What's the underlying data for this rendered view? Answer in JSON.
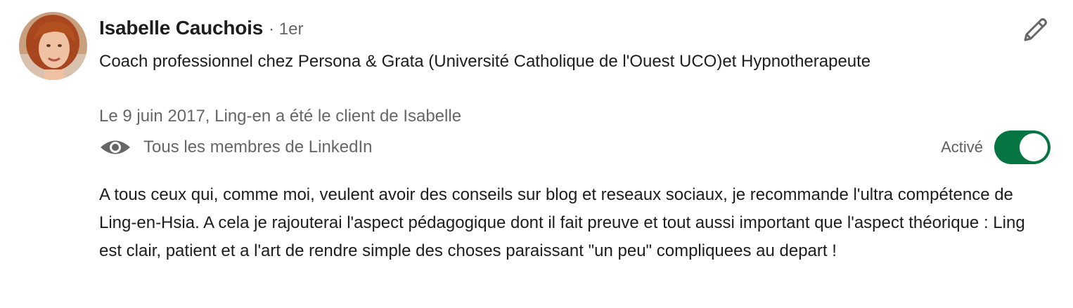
{
  "recommender": {
    "name": "Isabelle Cauchois",
    "degree": "· 1er",
    "headline": "Coach professionnel chez Persona & Grata (Université Catholique de l'Ouest UCO)et Hypnotherapeute",
    "relation": "Le 9 juin 2017, Ling-en a été le client de Isabelle"
  },
  "visibility": {
    "icon": "eye-icon",
    "label": "Tous les membres de LinkedIn"
  },
  "toggle": {
    "label": "Activé",
    "on": true,
    "color": "#057642"
  },
  "edit": {
    "icon": "pencil-icon"
  },
  "recommendation": {
    "text": "A tous ceux qui, comme moi, veulent avoir des conseils sur blog et reseaux sociaux, je recommande l'ultra compétence de Ling-en-Hsia. A cela je rajouterai l'aspect pédagogique dont il fait preuve et tout aussi important que l'aspect théorique : Ling est clair, patient et a l'art de rendre simple des choses paraissant \"un peu\" compliquees au depart !"
  }
}
